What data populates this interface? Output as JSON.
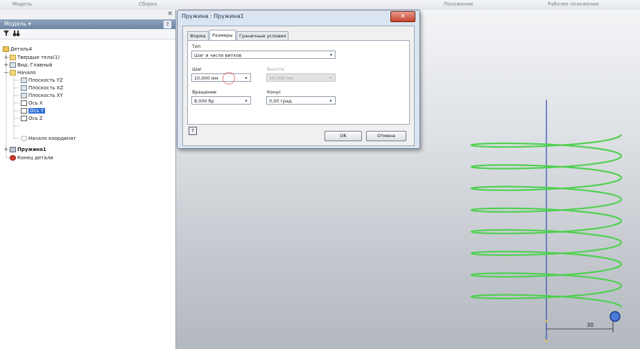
{
  "ribbon": {
    "left_label": "Модель",
    "mid_label": "Сборка",
    "right_label1": "Положение",
    "right_label2": "Рабочее положение"
  },
  "browser": {
    "close_glyph": "×",
    "header_title": "Модель ▾",
    "help_glyph": "?",
    "filter_icon": "filter-icon",
    "find_icon": "binoculars-icon",
    "tree": [
      {
        "label": "Деталь4",
        "icon": "part-icon"
      },
      {
        "label": "Твердые тела(1)",
        "icon": "solid-bodies-icon"
      },
      {
        "label": "Вид: Главный",
        "icon": "view-icon"
      },
      {
        "label": "Начало",
        "icon": "folder-icon"
      },
      {
        "label": "Плоскость YZ",
        "icon": "plane-icon"
      },
      {
        "label": "Плоскость XZ",
        "icon": "plane-icon"
      },
      {
        "label": "Плоскость XY",
        "icon": "plane-icon"
      },
      {
        "label": "Ось X",
        "icon": "axis-icon"
      },
      {
        "label": "Ось Y",
        "icon": "axis-icon"
      },
      {
        "label": "Ось Z",
        "icon": "axis-icon"
      },
      {
        "label": "Начало координат",
        "icon": "origin-point-icon"
      },
      {
        "label": "Пружина1",
        "icon": "spring-icon"
      },
      {
        "label": "Конец детали",
        "icon": "end-of-part-icon"
      }
    ]
  },
  "dialog": {
    "title": "Пружина : Пружина1",
    "close_glyph": "✕",
    "tabs": [
      "Форма",
      "Размеры",
      "Граничные условия"
    ],
    "active_tab": "Размеры",
    "type_label": "Тип",
    "type_value": "Шаг и число витков",
    "pitch_label": "Шаг",
    "pitch_value": "10,000 мм",
    "height_label": "Высота",
    "height_value": "10,000 мм",
    "revolution_label": "Вращение",
    "revolution_value": "8,000 бр",
    "taper_label": "Конус",
    "taper_value": "0,00 град",
    "arrow_glyph": "▸",
    "dropdown_glyph": "▾",
    "help_glyph": "?",
    "ok_label": "OK",
    "cancel_label": "Отмена"
  },
  "viewport": {
    "dimension_label": "30",
    "spring_color": "#4fd04f",
    "axis_color": "#2b49b8",
    "spring_turns": 8
  }
}
